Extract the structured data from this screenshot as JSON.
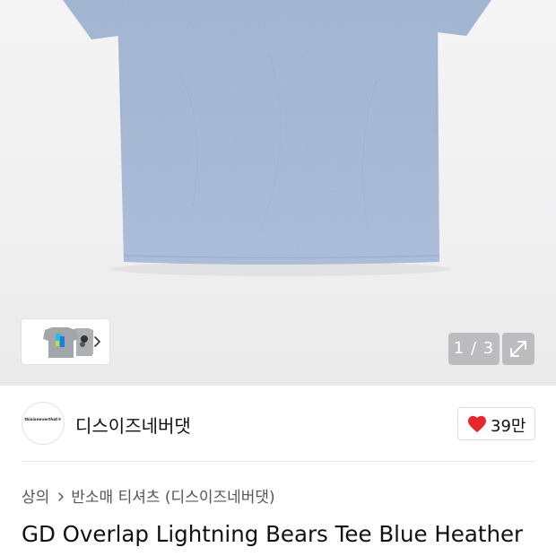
{
  "gallery": {
    "counter_text": "1 / 3",
    "thumbnail_count": 3,
    "shirt_color": "#a7bcd8",
    "icons": {
      "thumb_next": "chevron-right-icon",
      "fullscreen": "expand-icon"
    }
  },
  "brand": {
    "logo_text": "thisisneverthat®",
    "name": "디스이즈네버댓",
    "likes": "39만",
    "like_icon": "heart-icon",
    "like_color": "#e8262b"
  },
  "breadcrumb": {
    "category": "상의",
    "subcategory": "반소매 티셔츠 (디스이즈네버댓)"
  },
  "product": {
    "title": "GD Overlap Lightning Bears Tee Blue Heather"
  }
}
